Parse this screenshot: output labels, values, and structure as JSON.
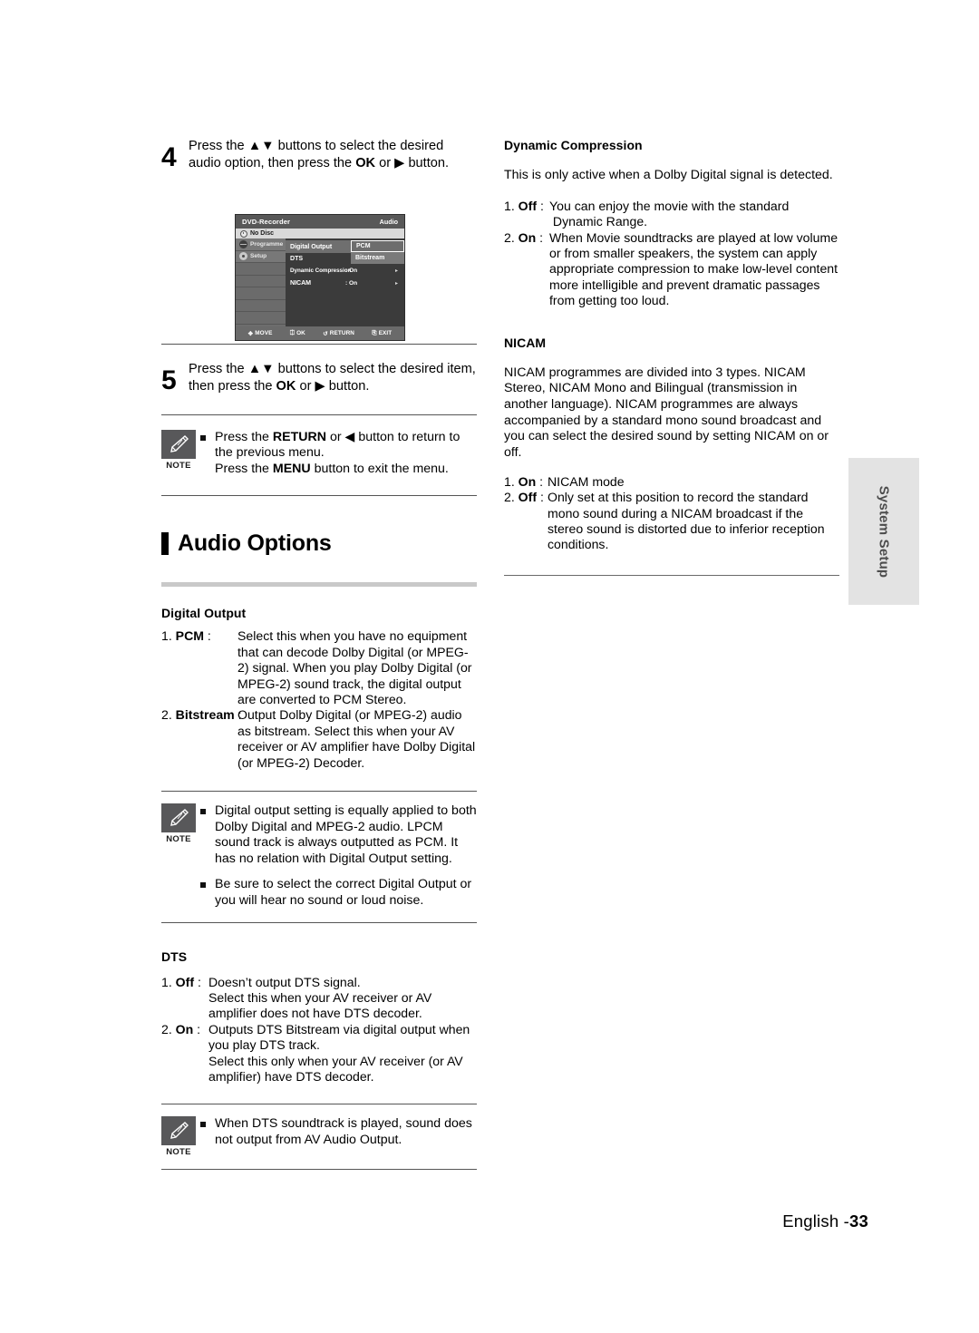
{
  "steps": [
    {
      "number": "4",
      "segments": [
        {
          "t": "Press the ",
          "b": false
        },
        {
          "t": "▲▼",
          "b": false
        },
        {
          "t": " buttons to select the desired audio option, then press the ",
          "b": false
        },
        {
          "t": "OK",
          "b": true
        },
        {
          "t": " or ▶ button.",
          "b": false
        }
      ],
      "text": "Press the ▲▼ buttons to select the desired audio option, then press the OK or ▶ button."
    },
    {
      "number": "5",
      "text": "Press the ▲▼ buttons to select the desired item, then press the OK or ▶ button."
    }
  ],
  "osd": {
    "title_left": "DVD-Recorder",
    "title_right": "Audio",
    "disc_status": "No Disc",
    "side_items": [
      {
        "label": "Programme",
        "icon": "globe-icon"
      },
      {
        "label": "Setup",
        "icon": "gear-icon"
      }
    ],
    "rows": [
      {
        "key": "Digital Output",
        "value": "",
        "arrow": "",
        "highlight": true
      },
      {
        "key": "DTS",
        "value": "",
        "arrow": "",
        "highlight": false
      },
      {
        "key": "Dynamic Compression",
        "value": ": On",
        "arrow": "▸",
        "highlight": false
      },
      {
        "key": "NICAM",
        "value": ": On",
        "arrow": "▸",
        "highlight": false
      }
    ],
    "submenu": [
      {
        "label": "PCM",
        "selected": true
      },
      {
        "label": "Bitstream",
        "selected": false
      }
    ],
    "footer": [
      {
        "glyph": "✥",
        "label": "MOVE",
        "icon": "dpad-icon"
      },
      {
        "glyph": "⌨",
        "label": "OK",
        "icon": "ok-button-icon"
      },
      {
        "glyph": "↺",
        "label": "RETURN",
        "icon": "return-icon"
      },
      {
        "glyph": "⌸",
        "label": "EXIT",
        "icon": "exit-icon"
      }
    ]
  },
  "notes": {
    "label": "NOTE",
    "note1": [
      "Press the RETURN or ◀ button to return to the previous menu.\nPress the MENU button to exit the menu."
    ],
    "note1_lines": {
      "l1a": "Press the ",
      "l1b": "RETURN",
      "l1c": " or ◀ button to return",
      "l2": "to the previous menu.",
      "l3a": "Press the ",
      "l3b": "MENU",
      "l3c": " button to exit the menu."
    },
    "note2": [
      "Digital output setting is equally applied to both Dolby Digital and MPEG-2 audio. LPCM sound track is always outputted as PCM. It has no relation with Digital Output setting.",
      "Be sure to select the correct Digital Output or you will hear no sound or loud noise."
    ],
    "note3": [
      "When DTS soundtrack is played, sound does not output from AV Audio Output."
    ]
  },
  "section": {
    "title": "Audio Options"
  },
  "digital_output": {
    "heading": "Digital Output",
    "items": [
      {
        "num": "1.",
        "term": "PCM",
        "colon": ":",
        "desc": "Select this when you have no equipment that can decode Dolby Digital (or MPEG-2) signal. When you play Dolby Digital (or MPEG-2) sound track, the digital output are converted to PCM Stereo."
      },
      {
        "num": "2.",
        "term": "Bitstream",
        "colon": ":",
        "desc": "Output Dolby Digital (or MPEG-2) audio as bitstream. Select this when your AV receiver or AV amplifier have Dolby Digital (or MPEG-2) Decoder."
      }
    ]
  },
  "dts": {
    "heading": "DTS",
    "items": [
      {
        "num": "1.",
        "term": "Off",
        "colon": ":",
        "desc": "Doesn’t output DTS signal. Select this when your AV receiver or AV amplifier does not have DTS decoder."
      },
      {
        "num": "2.",
        "term": "On",
        "colon": ":",
        "desc": "Outputs DTS Bitstream via digital output when you play DTS track. Select this only when your AV receiver (or AV amplifier) have DTS decoder."
      }
    ]
  },
  "dynamic_compression": {
    "heading": "Dynamic Compression",
    "intro": "This is only active when a Dolby Digital signal is detected.",
    "items": [
      {
        "num": "1.",
        "term": "Off",
        "colon": ":",
        "desc": "You can enjoy the movie with the standard Dynamic Range."
      },
      {
        "num": "2.",
        "term": "On",
        "colon": ":",
        "desc": "When Movie soundtracks are played at low volume or from smaller speakers, the system can apply appropriate compression to make low-level content more intelligible and prevent dramatic passages from getting too loud."
      }
    ]
  },
  "nicam": {
    "heading": "NICAM",
    "intro": "NICAM programmes are divided into 3 types. NICAM Stereo, NICAM Mono and Bilingual (transmission in another language). NICAM programmes are always accompanied by a standard mono sound broadcast and you can select the desired sound by setting NICAM on or off.",
    "items": [
      {
        "num": "1.",
        "term": "On",
        "colon": ":",
        "desc": "NICAM mode"
      },
      {
        "num": "2.",
        "term": "Off",
        "colon": ":",
        "desc": "Only set at this position to record the standard mono sound during a NICAM broadcast if the stereo sound is distorted due to inferior reception conditions."
      }
    ]
  },
  "side_tab": {
    "label": "System Setup"
  },
  "footer": {
    "language": "English -",
    "page": "33"
  },
  "colors": {
    "accent_grey": "#c9c9c9",
    "note_badge": "#58585a",
    "side_tab_bg": "#e3e3e3",
    "osd_bg": "#4f4f4f"
  }
}
